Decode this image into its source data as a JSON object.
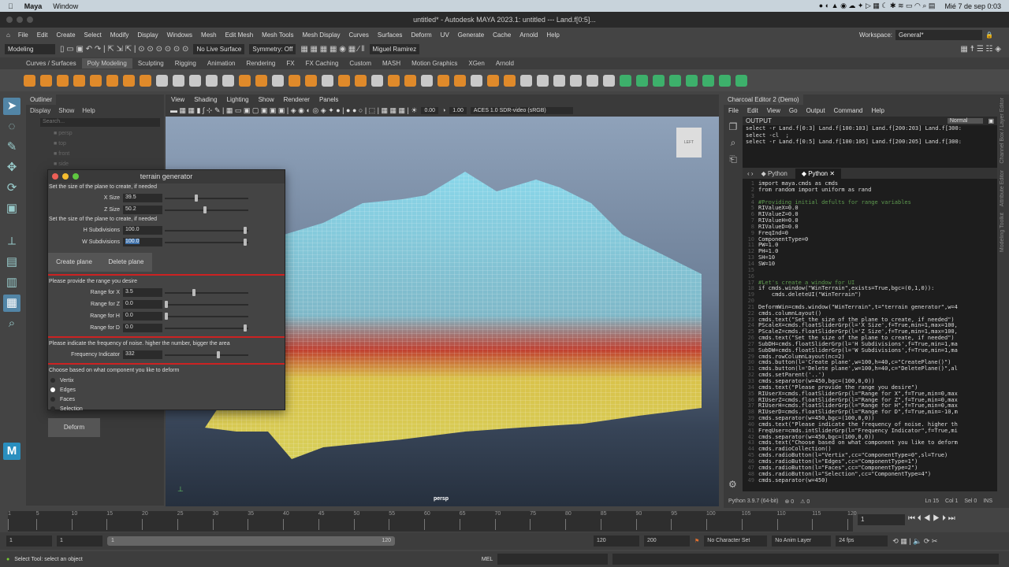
{
  "mac": {
    "app": "Maya",
    "menu": "Window",
    "clock": "Mié 7 de sep  0:03"
  },
  "window_title": "untitled* - Autodesk MAYA 2023.1: untitled  ---  Land.f[0:5]...",
  "menus": [
    "File",
    "Edit",
    "Create",
    "Select",
    "Modify",
    "Display",
    "Windows",
    "Mesh",
    "Edit Mesh",
    "Mesh Tools",
    "Mesh Display",
    "Curves",
    "Surfaces",
    "Deform",
    "UV",
    "Generate",
    "Cache",
    "Arnold",
    "Help"
  ],
  "workspace": {
    "label": "Workspace:",
    "value": "General*"
  },
  "toolbar": {
    "mode": "Modeling",
    "live_surface": "No Live Surface",
    "symmetry": "Symmetry: Off",
    "user": "Miguel Ramirez"
  },
  "shelf_tabs": [
    "Curves / Surfaces",
    "Poly Modeling",
    "Sculpting",
    "Rigging",
    "Animation",
    "Rendering",
    "FX",
    "FX Caching",
    "Custom",
    "MASH",
    "Motion Graphics",
    "XGen",
    "Arnold"
  ],
  "shelf_active": "Poly Modeling",
  "outliner": {
    "title": "Outliner",
    "menu": [
      "Display",
      "Show",
      "Help"
    ],
    "search_placeholder": "Search...",
    "items": [
      "persp",
      "top",
      "front",
      "side"
    ]
  },
  "viewport": {
    "menu": [
      "View",
      "Shading",
      "Lighting",
      "Show",
      "Renderer",
      "Panels"
    ],
    "exposure": "0.00",
    "gamma": "1.00",
    "colorspace": "ACES 1.0 SDR-video (sRGB)",
    "camera": "persp",
    "cube_label": "LEFT"
  },
  "dialog": {
    "title": "terrain generator",
    "text1": "Set the size of the plane to create, if needed",
    "xsize": {
      "label": "X Size",
      "value": "39.5",
      "fraction": 0.38
    },
    "zsize": {
      "label": "Z Size",
      "value": "50.2",
      "fraction": 0.49
    },
    "text2": "Set the size of the plane to create, if needed",
    "hsub": {
      "label": "H Subdivisions",
      "value": "100.0",
      "fraction": 1.0
    },
    "wsub": {
      "label": "W Subdivisions",
      "value": "100.0",
      "fraction": 1.0
    },
    "create": "Create plane",
    "delete": "Delete plane",
    "text3": "Please provide the range you desire",
    "rx": {
      "label": "Range for X",
      "value": "3.5",
      "fraction": 0.35
    },
    "rz": {
      "label": "Range for Z",
      "value": "0.0",
      "fraction": 0
    },
    "rh": {
      "label": "Range for H",
      "value": "0.0",
      "fraction": 0
    },
    "rd": {
      "label": "Range for D",
      "value": "0.0",
      "fraction": 1.0
    },
    "text4": "Please indicate the frequency of noise. higher the number, bigger the area",
    "freq": {
      "label": "Frequency Indicator",
      "value": "332",
      "fraction": 0.66
    },
    "text5": "Choose based on what component you like to deform",
    "radios": [
      "Vertix",
      "Edges",
      "Faces",
      "Selection"
    ],
    "radio_selected": 1,
    "deform": "Deform"
  },
  "charcoal": {
    "title": "Charcoal Editor 2 (Demo)",
    "menu": [
      "File",
      "Edit",
      "View",
      "Go",
      "Output",
      "Command",
      "Help"
    ],
    "output_label": "OUTPUT",
    "output_mode": "Normal",
    "output_lines": [
      "select -r Land.f[0:3] Land.f[100:103] Land.f[200:203] Land.f[300:",
      "select -cl  ;",
      "select -r Land.f[0:5] Land.f[100:105] Land.f[200:205] Land.f[300:"
    ],
    "tabs": [
      "Python",
      "Python"
    ],
    "code": [
      "import maya.cmds as cmds",
      "from random import uniform as rand",
      "",
      "#Providing initial defults for range variables",
      "RIValueX=0.0",
      "RIValueZ=0.0",
      "RIValueH=0.0",
      "RIValueD=0.0",
      "FreqInd=0",
      "ComponentType=0",
      "PW=1.0",
      "PH=1.0",
      "SH=10",
      "SW=10",
      "",
      "",
      "#Let's create a window for UI",
      "if cmds.window(\"WinTerrain\",exists=True,bgc=(0,1,0)):",
      "    cmds.deleteUI(\"WinTerrain\")",
      "",
      "DeformWin=cmds.window(\"WinTerrain\",t=\"terrain generator\",w=4",
      "cmds.columnLayout()",
      "cmds.text(\"Set the size of the plane to create, if needed\")",
      "PScaleX=cmds.floatSliderGrp(l='X Size',f=True,min=1,max=100,",
      "PScaleZ=cmds.floatSliderGrp(l='Z Size',f=True,min=1,max=100,",
      "cmds.text(\"Set the size of the plane to create, if needed\")",
      "SubDH=cmds.floatSliderGrp(l='H Subdivisions',f=True,min=1,ma",
      "SubDW=cmds.floatSliderGrp(l='W Subdivisions',f=True,min=1,ma",
      "cmds.rowColumnLayout(nc=2)",
      "cmds.button(l='Create plane',w=100,h=40,c=\"CreatePlane()\")",
      "cmds.button(l='Delete plane',w=100,h=40,c=\"DeletePlane()\",al",
      "cmds.setParent('..')",
      "cmds.separator(w=450,bgc=(100,0,0))",
      "cmds.text(\"Please provide the range you desire\")",
      "RIUserX=cmds.floatSliderGrp(l=\"Range for X\",f=True,min=0,max",
      "RIUserZ=cmds.floatSliderGrp(l=\"Range for Z\",f=True,min=0,max",
      "RIUserH=cmds.floatSliderGrp(l=\"Range for H\",f=True,min=0,max",
      "RIUserD=cmds.floatSliderGrp(l=\"Range for D\",f=True,min=-10,m",
      "cmds.separator(w=450,bgc=(100,0,0))",
      "cmds.text(\"Please indicate the frequency of noise. higher th",
      "FreqUser=cmds.intSliderGrp(l=\"Frequency Indicator\",f=True,mi",
      "cmds.separator(w=450,bgc=(100,0,0))",
      "cmds.text(\"Choose based on what component you like to deform",
      "cmds.radioCollection()",
      "cmds.radioButton(l=\"Vertix\",cc=\"ComponentType=0\",sl=True)",
      "cmds.radioButton(l=\"Edges\",cc=\"ComponentType=1\")",
      "cmds.radioButton(l=\"Faces\",cc=\"ComponentType=2\")",
      "cmds.radioButton(l=\"Selection\",cc=\"ComponentType=4\")",
      "cmds.separator(w=450)"
    ],
    "status": {
      "python": "Python 3.9.7 (64-bit)",
      "errors": "0",
      "warnings": "0",
      "ln": "Ln 15",
      "col": "Col 1",
      "sel": "Sel 0",
      "mode": "INS"
    }
  },
  "right_tabs": [
    "Channel Box / Layer Editor",
    "Attribute Editor",
    "Modeling Toolkit"
  ],
  "timeline": {
    "ticks": [
      "1",
      "5",
      "10",
      "15",
      "20",
      "25",
      "30",
      "35",
      "40",
      "45",
      "50",
      "55",
      "60",
      "65",
      "70",
      "75",
      "80",
      "85",
      "90",
      "95",
      "100",
      "105",
      "110",
      "115",
      "120"
    ],
    "current": "1",
    "current_field": "1"
  },
  "range": {
    "start": "1",
    "anim_start": "1",
    "range_start": "1",
    "range_end": "120",
    "end": "120",
    "anim_end": "200",
    "character_set": "No Character Set",
    "anim_layer": "No Anim Layer",
    "fps": "24 fps"
  },
  "status": {
    "help": "Select Tool: select an object",
    "lang": "MEL"
  }
}
